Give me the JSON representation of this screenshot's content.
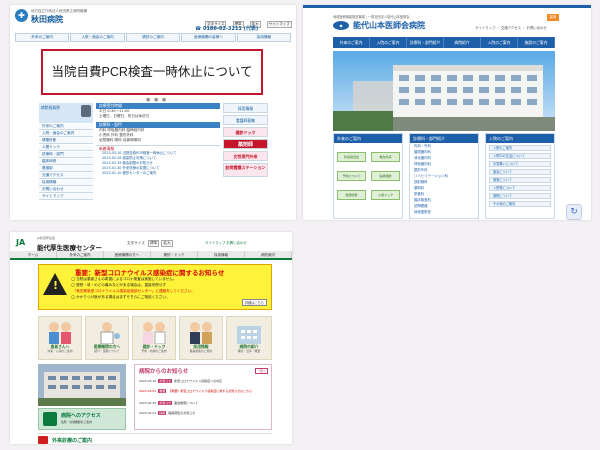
{
  "akita": {
    "subtitle": "地方独立行政法人秋田県立病院機構",
    "name": "秋田病院",
    "font_controls": [
      "文字サイズ",
      "標準",
      "拡大",
      "サイトマップ"
    ],
    "tel": "☎ 0186-62-3211 (代表)",
    "nav": [
      "外来のご案内",
      "入院・面会のご案内",
      "健診のご案内",
      "医療機関の皆様へ",
      "採用情報"
    ],
    "banner": "当院自費PCR検査一時休止について",
    "dots": "● ● ●",
    "director": "病院長挨拶",
    "left_menu": [
      "外来のご案内",
      "入院・面会のご案内",
      "健康診断",
      "人間ドック",
      "診療科・部門",
      "臨床研修",
      "看護部",
      "交通アクセス",
      "採用情報",
      "お問い合わせ",
      "サイトマップ"
    ],
    "hours_bar": "診療受付時間",
    "hours": [
      "平日 8:30～11:00",
      "土曜日、日曜日、祝日は休診日"
    ],
    "dept_bar": "診療科・部門",
    "dept_rows": [
      "内科 呼吸器内科 脳神経内科",
      "小児科 外科 整形外科",
      "泌尿器科 眼科 耳鼻咽喉科"
    ],
    "news_bar": "新着情報",
    "news": [
      "2023.03.10 当院自費PCR検査一時休止について",
      "2023.02.28 感染防止対策について",
      "2023.02.15 面会制限のお知らせ",
      "2023.01.30 外来診療の変更について",
      "2023.01.10 健診センターのご案内"
    ],
    "right_menu": [
      "採用情報",
      "看護師募集",
      "健診ドック",
      "薬剤師",
      "女性専門外来",
      "訪問看護ステーション"
    ]
  },
  "noshiro": {
    "subtitle": "地域医療機能推進機構 / 一般社団法人能代山本医師会",
    "name": "能代山本医師会病院",
    "badge": "採用",
    "links": "サイトマップ ・ 交通アクセス ・ お問い合わせ",
    "nav": [
      "外来のご案内",
      "入院のご案内",
      "診療科・部門紹介",
      "病院紹介",
      "入院のご案内",
      "施設のご案内"
    ],
    "panel1_title": "外来のご案内",
    "panel1_buttons": [
      "外来担当表",
      "救急外来",
      "予約について",
      "医療相談",
      "健康診断",
      "人間ドック"
    ],
    "panel2_title": "診療科・部門紹介",
    "panel2_items": [
      "内科・外科",
      "循環器内科",
      "消化器内科",
      "呼吸器内科",
      "整形外科",
      "リハビリテーション科",
      "放射線科",
      "薬剤科",
      "栄養科",
      "臨床検査科",
      "訪問看護",
      "地域連携室"
    ],
    "panel3_title": "入院のご案内",
    "panel3_items": [
      "入院のご案内",
      "入院中の生活について",
      "お見舞いについて",
      "面会について",
      "個室について",
      "入院費について",
      "退院について",
      "その他のご案内"
    ],
    "recaptcha": "↻"
  },
  "yamamoto": {
    "subtitle": "JA秋田厚生連",
    "logo": "JA",
    "name": "能代厚生医療センター",
    "font_label": "文字サイズ",
    "font_buttons": [
      "標準",
      "拡大"
    ],
    "global_links": "サイトマップ  お問い合わせ",
    "nav": [
      "ホーム",
      "外来のご案内",
      "医療機関の方へ",
      "健診・ドック",
      "採用情報",
      "病院案内"
    ],
    "alert_title": "重要：新型コロナウイルス感染症に関するお知らせ",
    "alert_lines": [
      "◯ 当院は患者さんの希望によるコロナ検査は実施していません。",
      "◯ 発熱・咳・のどの痛みなどがある場合は、直接来院せず",
      "　「秋田県新型コロナウイルス感染症相談センター」に連絡をしてください。",
      "◯ かかりつけ医がある場合はまずそちらにご相談ください。"
    ],
    "alert_more": "詳細はこちら",
    "cards": [
      {
        "label": "患者さんへ",
        "sub": "外来・入院のご案内"
      },
      {
        "label": "医療機関の方へ",
        "sub": "紹介・連携について"
      },
      {
        "label": "健診・ドック",
        "sub": "予約・内容のご案内"
      },
      {
        "label": "採用情報",
        "sub": "職員募集のご案内"
      },
      {
        "label": "病院の紹介",
        "sub": "理念・沿革・概要"
      }
    ],
    "access_title": "病院へのアクセス",
    "access_sub": "住所・交通機関のご案内",
    "news_title": "病院からのお知らせ",
    "news_list": "一覧へ",
    "news_items": [
      {
        "date": "2023.03.10",
        "tag": "お知らせ",
        "text": "新型コロナウイルス感染症への対応"
      },
      {
        "date": "2023.03.01",
        "tag": "重要",
        "text": "【重要】新型コロナウイルス感染症に関するお知らせはこちら"
      },
      {
        "date": "2023.02.20",
        "tag": "お知らせ",
        "text": "面会制限について"
      },
      {
        "date": "2023.02.01",
        "tag": "採用",
        "text": "職員募集のお知らせ"
      }
    ],
    "footer": "外来診療のご案内"
  }
}
